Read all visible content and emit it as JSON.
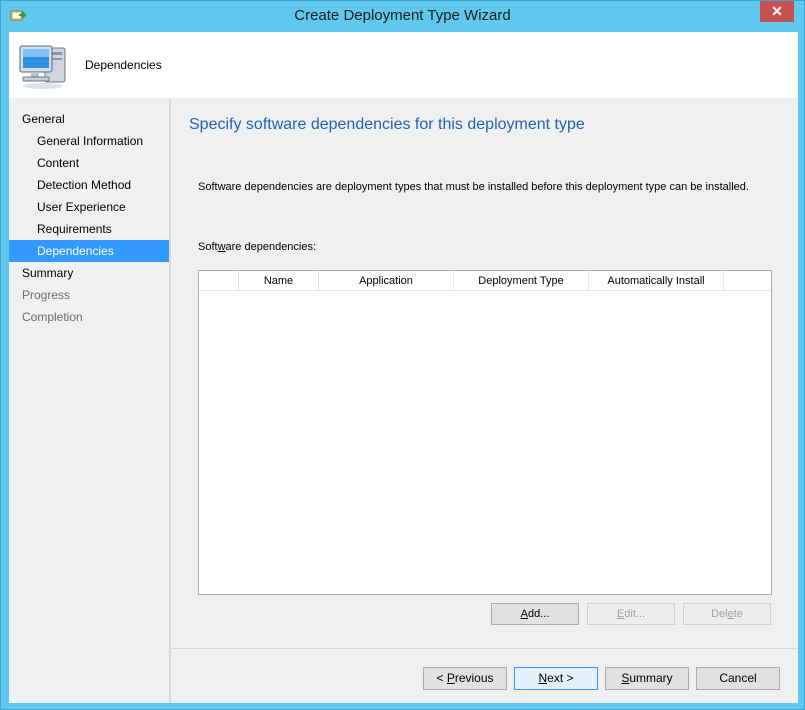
{
  "window": {
    "title": "Create Deployment Type Wizard",
    "close_glyph": "✕"
  },
  "header": {
    "title": "Dependencies",
    "icon": "computer-icon"
  },
  "nav": {
    "items": [
      {
        "label": "General",
        "level": 0,
        "state": "normal"
      },
      {
        "label": "General Information",
        "level": 1,
        "state": "normal"
      },
      {
        "label": "Content",
        "level": 1,
        "state": "normal"
      },
      {
        "label": "Detection Method",
        "level": 1,
        "state": "normal"
      },
      {
        "label": "User Experience",
        "level": 1,
        "state": "normal"
      },
      {
        "label": "Requirements",
        "level": 1,
        "state": "normal"
      },
      {
        "label": "Dependencies",
        "level": 1,
        "state": "selected"
      },
      {
        "label": "Summary",
        "level": 0,
        "state": "normal"
      },
      {
        "label": "Progress",
        "level": 0,
        "state": "disabled"
      },
      {
        "label": "Completion",
        "level": 0,
        "state": "disabled"
      }
    ]
  },
  "main": {
    "heading": "Specify software dependencies for this deployment type",
    "description": "Software dependencies are deployment types that must be installed before this deployment type can be installed.",
    "list_label_pre": "Soft",
    "list_label_key": "w",
    "list_label_post": "are dependencies:",
    "columns": [
      "",
      "Name",
      "Application",
      "Deployment Type",
      "Automatically Install",
      ""
    ],
    "rows": []
  },
  "buttons": {
    "add_key": "A",
    "add_rest": "dd...",
    "edit_key": "E",
    "edit_rest": "dit...",
    "delete_pre": "Del",
    "delete_key": "e",
    "delete_post": "te"
  },
  "footer": {
    "previous_pre": "< ",
    "previous_key": "P",
    "previous_rest": "revious",
    "next_key": "N",
    "next_rest": "ext >",
    "summary_key": "S",
    "summary_rest": "ummary",
    "cancel_label": "Cancel"
  },
  "colors": {
    "titlebar": "#5fc8ec",
    "selection": "#3399ff",
    "heading": "#1e63b4",
    "close": "#c75050"
  }
}
